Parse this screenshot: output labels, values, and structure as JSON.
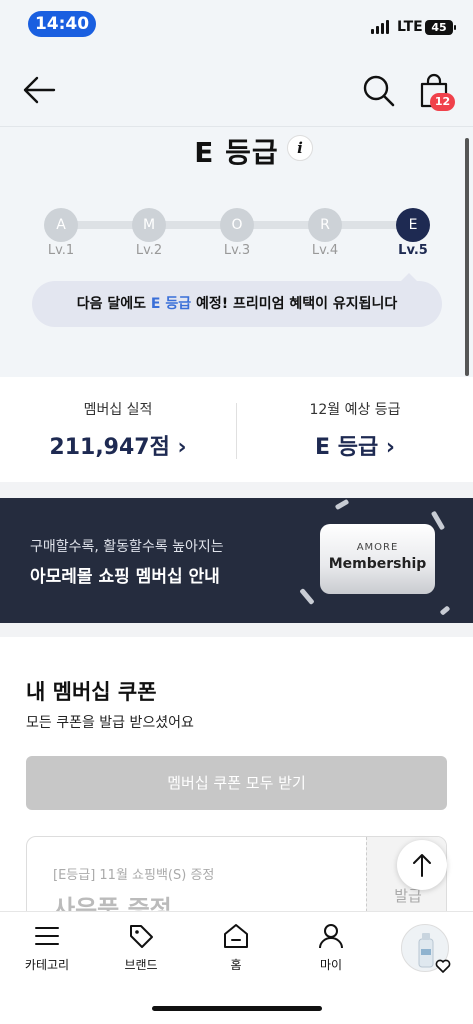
{
  "status_bar": {
    "time": "14:40",
    "network": "LTE",
    "battery": "45"
  },
  "header": {
    "cart_count": "12"
  },
  "grade": {
    "title": "E 등급",
    "info_label": "i",
    "levels": [
      {
        "letter": "A",
        "label": "Lv.1"
      },
      {
        "letter": "M",
        "label": "Lv.2"
      },
      {
        "letter": "O",
        "label": "Lv.3"
      },
      {
        "letter": "R",
        "label": "Lv.4"
      },
      {
        "letter": "E",
        "label": "Lv.5"
      }
    ],
    "current_level_index": 4,
    "message_pre": "다음 달에도 ",
    "message_accent": "E 등급",
    "message_post": " 예정! 프리미엄 혜택이 유지됩니다"
  },
  "stats": {
    "performance_label": "멤버십 실적",
    "performance_value": "211,947점 ›",
    "expected_label": "12월 예상 등급",
    "expected_value": "E 등급 ›"
  },
  "banner": {
    "subtitle": "구매할수록, 활동할수록 높아지는",
    "title": "아모레몰 쇼핑 멤버십 안내",
    "card_top": "AMORE",
    "card_bottom": "Membership"
  },
  "coupons": {
    "title": "내 멤버십 쿠폰",
    "subtitle": "모든 쿠폰을 발급 받으셨어요",
    "all_button": "멤버십 쿠폰 모두 받기",
    "items": [
      {
        "tag": "[E등급] 11월 쇼핑백(S) 증정",
        "name": "사은품 증정",
        "action": "발급"
      }
    ]
  },
  "bottom_nav": {
    "items": [
      {
        "label": "카테고리",
        "icon": "menu-icon"
      },
      {
        "label": "브랜드",
        "icon": "tag-icon"
      },
      {
        "label": "홈",
        "icon": "home-icon"
      },
      {
        "label": "마이",
        "icon": "person-icon"
      }
    ]
  }
}
